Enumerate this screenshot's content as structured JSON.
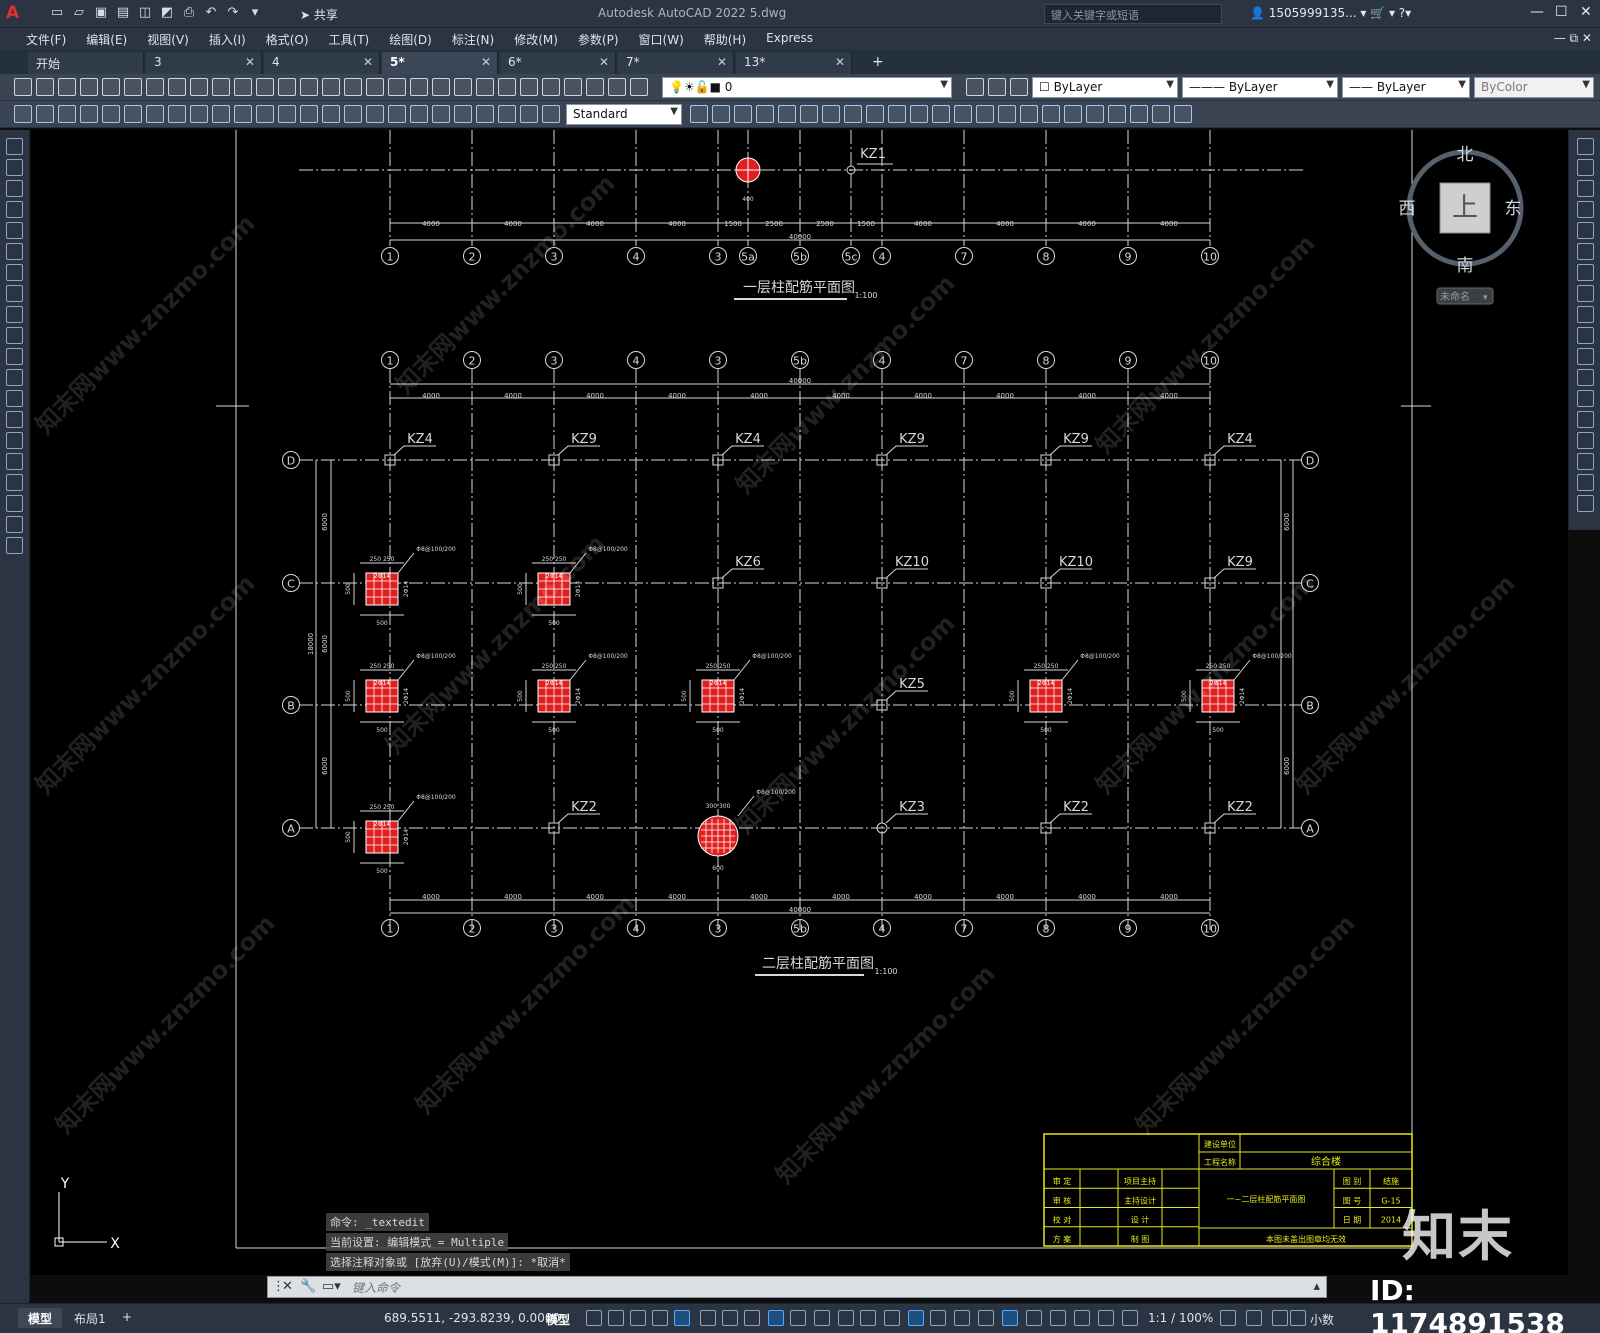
{
  "titlebar": {
    "app_title": "Autodesk AutoCAD 2022    5.dwg",
    "share_label": "共享",
    "search_placeholder": "键入关键字或短语",
    "user_name": "1505999135..."
  },
  "menu": [
    "文件(F)",
    "编辑(E)",
    "视图(V)",
    "插入(I)",
    "格式(O)",
    "工具(T)",
    "绘图(D)",
    "标注(N)",
    "修改(M)",
    "参数(P)",
    "窗口(W)",
    "帮助(H)",
    "Express"
  ],
  "tabs": [
    {
      "label": "开始",
      "active": false,
      "closable": false
    },
    {
      "label": "3",
      "active": false,
      "closable": true
    },
    {
      "label": "4",
      "active": false,
      "closable": true
    },
    {
      "label": "5*",
      "active": true,
      "closable": true
    },
    {
      "label": "6*",
      "active": false,
      "closable": true
    },
    {
      "label": "7*",
      "active": false,
      "closable": true
    },
    {
      "label": "13*",
      "active": false,
      "closable": true
    }
  ],
  "properties": {
    "layer": "0",
    "color": "ByLayer",
    "linetype": "ByLayer",
    "lineweight": "ByLayer",
    "plotstyle": "ByColor",
    "text_style": "Standard"
  },
  "viewcube": {
    "north": "北",
    "south": "南",
    "east": "东",
    "west": "西",
    "top": "上",
    "wcs": "未命名"
  },
  "drawing": {
    "plan1_title": "一层柱配筋平面图",
    "plan2_title": "二层柱配筋平面图",
    "scale_label": "1:100",
    "top_axes": [
      "1",
      "2",
      "3",
      "4",
      "3",
      "5a",
      "5b",
      "5c",
      "4",
      "7",
      "8",
      "9",
      "10"
    ],
    "plan1_dims": [
      "4000",
      "4000",
      "4000",
      "4000",
      "1500",
      "2500",
      "2500",
      "1500",
      "4000",
      "4000",
      "4000",
      "4000"
    ],
    "total_dim": "40000",
    "kz1_label": "KZ1",
    "mid_axes": [
      "1",
      "2",
      "3",
      "4",
      "3",
      "5b",
      "4",
      "7",
      "8",
      "9",
      "10"
    ],
    "bottom_axes": [
      "1",
      "2",
      "3",
      "4",
      "3",
      "5b",
      "4",
      "7",
      "8",
      "9",
      "10"
    ],
    "row_axes": [
      "D",
      "C",
      "B",
      "A"
    ],
    "span_dim": "4000",
    "row_dims": [
      "6000",
      "6000",
      "6000"
    ],
    "total_depth": "18000",
    "row_D_labels": [
      "KZ4",
      "KZ9",
      "KZ4",
      "KZ9",
      "KZ9",
      "KZ4"
    ],
    "row_C_labels": [
      "KZ6",
      "KZ10",
      "KZ10",
      "KZ9"
    ],
    "row_B_labels": [
      "KZ5"
    ],
    "row_A_labels": [
      "KZ2",
      "KZ3",
      "KZ2",
      "KZ2"
    ],
    "column_detail_dims": [
      "250",
      "500",
      "2Φ14",
      "Φ8@100/200"
    ]
  },
  "titleblock": {
    "builder_label": "建设单位",
    "project_label": "工程名称",
    "project_name": "综合楼",
    "left_rows": [
      "审 定",
      "审 核",
      "校 对",
      "方 案"
    ],
    "mid_rows": [
      "项目主持",
      "主持设计",
      "设 计",
      "制 图"
    ],
    "drawing_name": "一~二层柱配筋平面图",
    "right_rows": [
      "图 别",
      "图 号",
      "日 期"
    ],
    "right_values": [
      "结施",
      "G-15",
      "2014"
    ],
    "footer_note": "本图未盖出图章均无效"
  },
  "command": {
    "history": [
      "命令: _textedit",
      "当前设置: 编辑模式 = Multiple",
      "选择注释对象或 [放弃(U)/模式(M)]: *取消*"
    ],
    "placeholder": "键入命令"
  },
  "status": {
    "layout_tabs": [
      "模型",
      "布局1"
    ],
    "coords": "689.5511, -293.8239, 0.0000",
    "mode": "模型",
    "annotation_scale": "1:1 / 100%",
    "units": "小数"
  },
  "watermark": {
    "brand": "知末",
    "id": "ID: 1174891538",
    "diagonal": "知末网www.znzmo.com"
  },
  "ucs": {
    "x": "X",
    "y": "Y"
  },
  "colors": {
    "canvas": "#000000",
    "ui_dark": "#2b3442",
    "toolbar": "#3b4453",
    "column_fill": "#e02020",
    "titleblock": "#e8e81a",
    "linework": "#d8d8d8"
  }
}
